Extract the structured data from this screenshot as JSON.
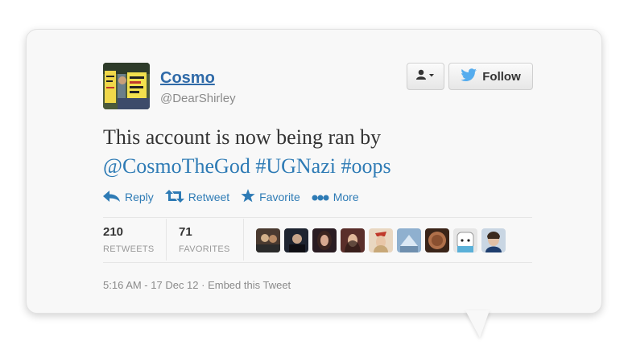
{
  "tweet": {
    "name": "Cosmo",
    "handle": "@DearShirley",
    "text_prefix": "This account is now being ran by",
    "mentions": [
      "@CosmoTheGod",
      "#UGNazi",
      "#oops"
    ],
    "timestamp": "5:16 AM - 17 Dec 12 · Embed this Tweet"
  },
  "buttons": {
    "user_menu_icon": "user-dropdown-icon",
    "follow_label": "Follow"
  },
  "actions": [
    {
      "label": "Reply",
      "icon": "reply-icon"
    },
    {
      "label": "Retweet",
      "icon": "retweet-icon"
    },
    {
      "label": "Favorite",
      "icon": "star-icon"
    },
    {
      "label": "More",
      "icon": "more-dots-icon"
    }
  ],
  "stats": {
    "retweets": {
      "value": "210",
      "label": "RETWEETS"
    },
    "favorites": {
      "value": "71",
      "label": "FAVORITES"
    }
  },
  "colors": {
    "link": "#2e7bb5",
    "name": "#2f6aa8",
    "twitter_bird": "#55acee"
  }
}
